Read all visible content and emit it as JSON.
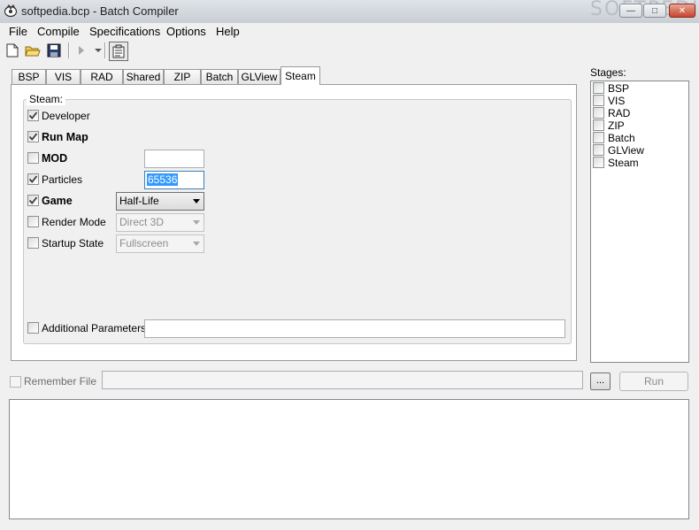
{
  "window": {
    "title": "softpedia.bcp - Batch Compiler",
    "watermark": "SOFTPEDIA",
    "watermark_url": "www.softpedia.com",
    "close_glyph": "✕",
    "max_glyph": "□",
    "min_glyph": "—"
  },
  "menu": [
    "File",
    "Compile",
    "Specifications",
    "Options",
    "Help"
  ],
  "toolbar": {
    "icons": [
      "new-file-icon",
      "open-folder-icon",
      "save-icon",
      "play-icon",
      "dropdown-arrow-icon",
      "properties-icon"
    ]
  },
  "tabs": [
    "BSP",
    "VIS",
    "RAD",
    "Shared",
    "ZIP",
    "Batch",
    "GLView",
    "Steam"
  ],
  "active_tab": "Steam",
  "steam": {
    "group_label": "Steam:",
    "developer": {
      "label": "Developer",
      "checked": true
    },
    "run_map": {
      "label": "Run Map",
      "checked": true
    },
    "mod": {
      "label": "MOD",
      "checked": false,
      "value": ""
    },
    "particles": {
      "label": "Particles",
      "checked": true,
      "value": "65536"
    },
    "game": {
      "label": "Game",
      "checked": true,
      "value": "Half-Life"
    },
    "render_mode": {
      "label": "Render Mode",
      "checked": false,
      "value": "Direct 3D"
    },
    "startup_state": {
      "label": "Startup State",
      "checked": false,
      "value": "Fullscreen"
    },
    "additional_parameters": {
      "label": "Additional Parameters",
      "checked": false,
      "value": ""
    }
  },
  "stages": {
    "label": "Stages:",
    "items": [
      "BSP",
      "VIS",
      "RAD",
      "ZIP",
      "Batch",
      "GLView",
      "Steam"
    ]
  },
  "bottom": {
    "remember_label": "Remember File",
    "remember_value": "",
    "browse_label": "...",
    "run_label": "Run"
  },
  "colors": {
    "selection": "#3399ff",
    "close_button": "#c7452d"
  }
}
